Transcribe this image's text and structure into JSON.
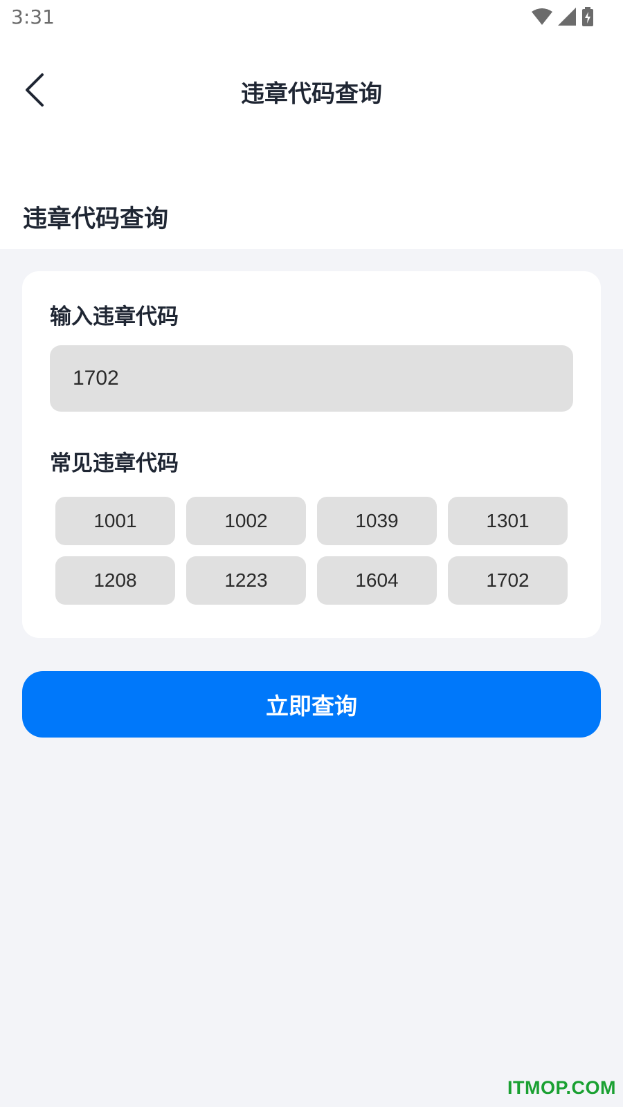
{
  "status_bar": {
    "time": "3:31",
    "icons": [
      "wifi-icon",
      "cell-signal-icon",
      "battery-charging-icon"
    ]
  },
  "nav": {
    "back_icon": "chevron-left-icon",
    "title": "违章代码查询"
  },
  "section": {
    "title": "违章代码查询"
  },
  "card": {
    "input_label": "输入违章代码",
    "input_value": "1702",
    "common_label": "常见违章代码",
    "codes": [
      "1001",
      "1002",
      "1039",
      "1301",
      "1208",
      "1223",
      "1604",
      "1702"
    ]
  },
  "actions": {
    "query_label": "立即查询"
  },
  "watermark": "ITMOP.COM",
  "colors": {
    "accent": "#0078fa",
    "background": "#f3f4f8",
    "chip": "#e0e0e0",
    "title": "#1f2633",
    "watermark": "#1aa032"
  }
}
